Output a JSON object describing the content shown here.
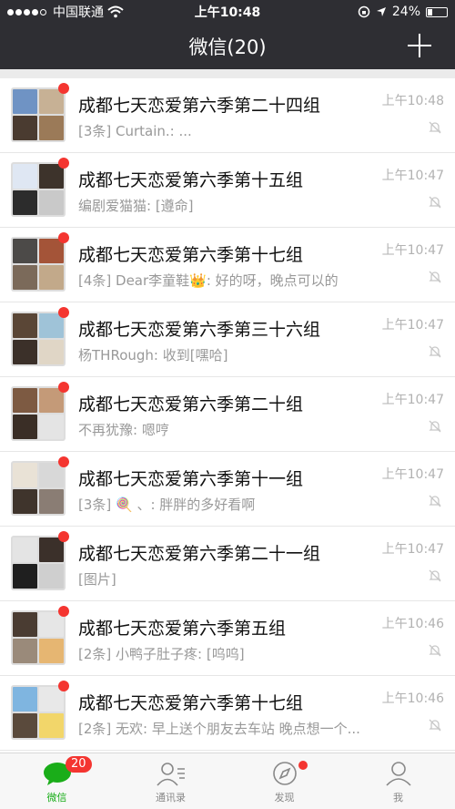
{
  "status_bar": {
    "carrier": "中国联通",
    "time": "上午10:48",
    "battery": "24%"
  },
  "nav": {
    "title": "微信(20)"
  },
  "chats": [
    {
      "name": "成都七天恋爱第六季第二十四组",
      "preview": "[3条] Curtain.: ...",
      "time": "上午10:48"
    },
    {
      "name": "成都七天恋爱第六季第十五组",
      "preview": "编剧爱猫猫: [遵命]",
      "time": "上午10:47"
    },
    {
      "name": "成都七天恋爱第六季第十七组",
      "preview": "[4条] Dear李童鞋👑: 好的呀，晚点可以的",
      "time": "上午10:47"
    },
    {
      "name": "成都七天恋爱第六季第三十六组",
      "preview": "杨THRough: 收到[嘿哈]",
      "time": "上午10:47"
    },
    {
      "name": "成都七天恋爱第六季第二十组",
      "preview": "不再犹豫: 嗯哼",
      "time": "上午10:47"
    },
    {
      "name": "成都七天恋爱第六季第十一组",
      "preview": "[3条] 🍭 、: 胖胖的多好看啊",
      "time": "上午10:47"
    },
    {
      "name": "成都七天恋爱第六季第二十一组",
      "preview": "[图片]",
      "time": "上午10:47"
    },
    {
      "name": "成都七天恋爱第六季第五组",
      "preview": "[2条] 小鸭子肚子疼: [呜呜]",
      "time": "上午10:46"
    },
    {
      "name": "成都七天恋爱第六季第十七组",
      "preview": "[2条] 无欢: 早上送个朋友去车站 晚点想一个...",
      "time": "上午10:46"
    }
  ],
  "tabbar": {
    "tabs": [
      {
        "label": "微信",
        "icon": "chat-bubble-icon",
        "badge": "20"
      },
      {
        "label": "通讯录",
        "icon": "contacts-icon"
      },
      {
        "label": "发现",
        "icon": "compass-icon"
      },
      {
        "label": "我",
        "icon": "person-icon"
      }
    ]
  },
  "colors": {
    "header_bg": "#2e2e33",
    "accent_green": "#1aad19",
    "badge_red": "#f43530"
  }
}
